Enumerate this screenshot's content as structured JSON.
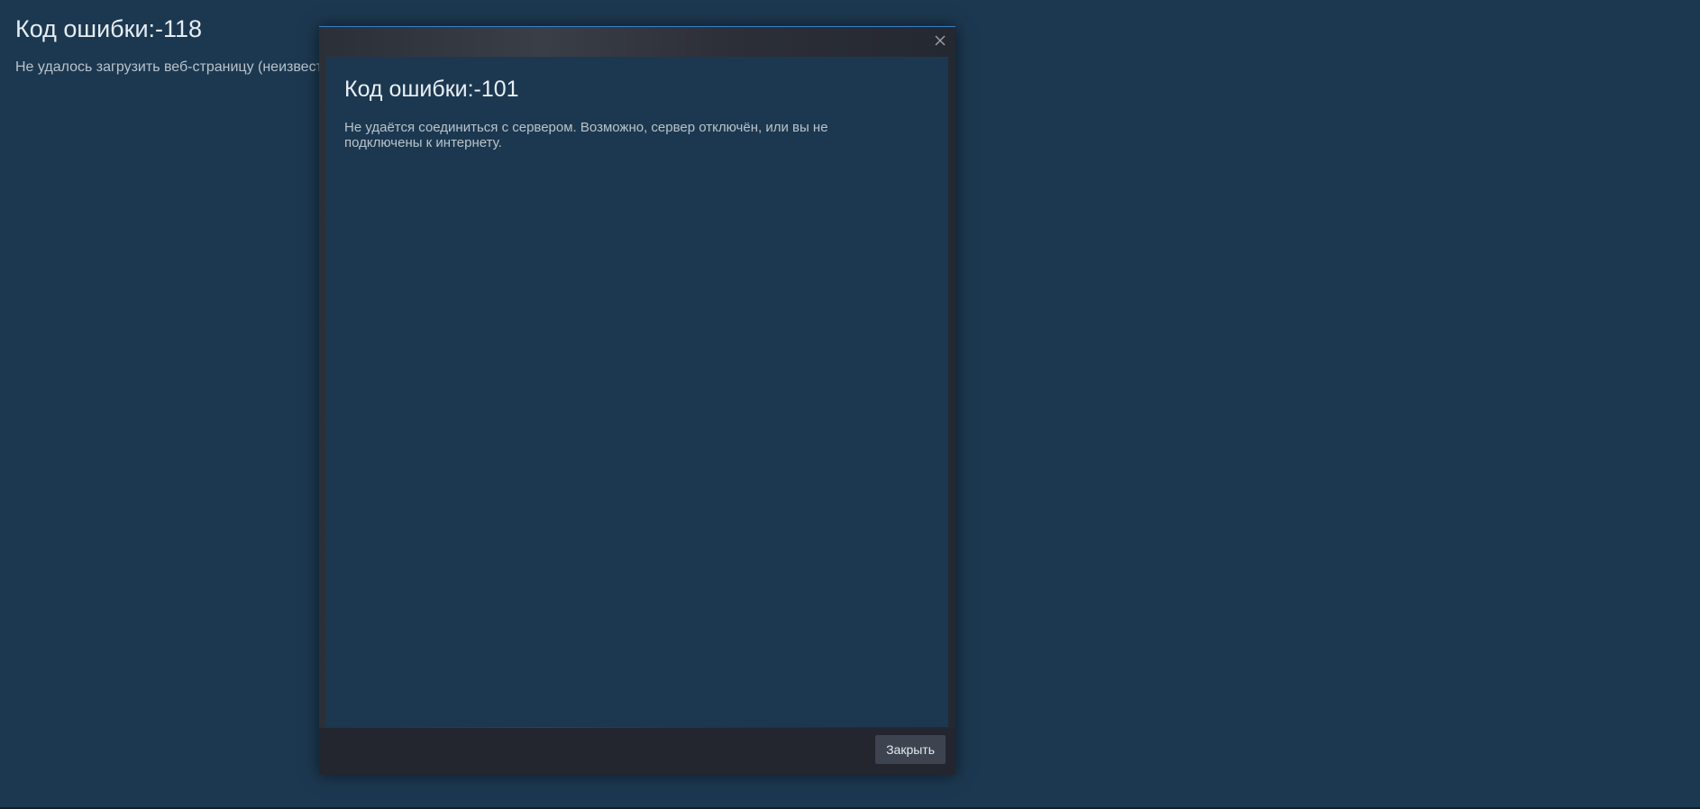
{
  "background_page": {
    "title": "Код ошибки:-118",
    "description": "Не удалось загрузить веб-страницу (неизвест"
  },
  "dialog": {
    "close_icon": "close-icon",
    "title": "Код ошибки:-101",
    "description": "Не удаётся соединиться с сервером. Возможно, сервер отключён, или вы не подключены к интернету.",
    "close_button_label": "Закрыть"
  },
  "colors": {
    "page_background": "#1c3850",
    "dialog_accent_top": "#3a7fc8",
    "dialog_footer": "#23262e",
    "button": "#3d4450"
  }
}
